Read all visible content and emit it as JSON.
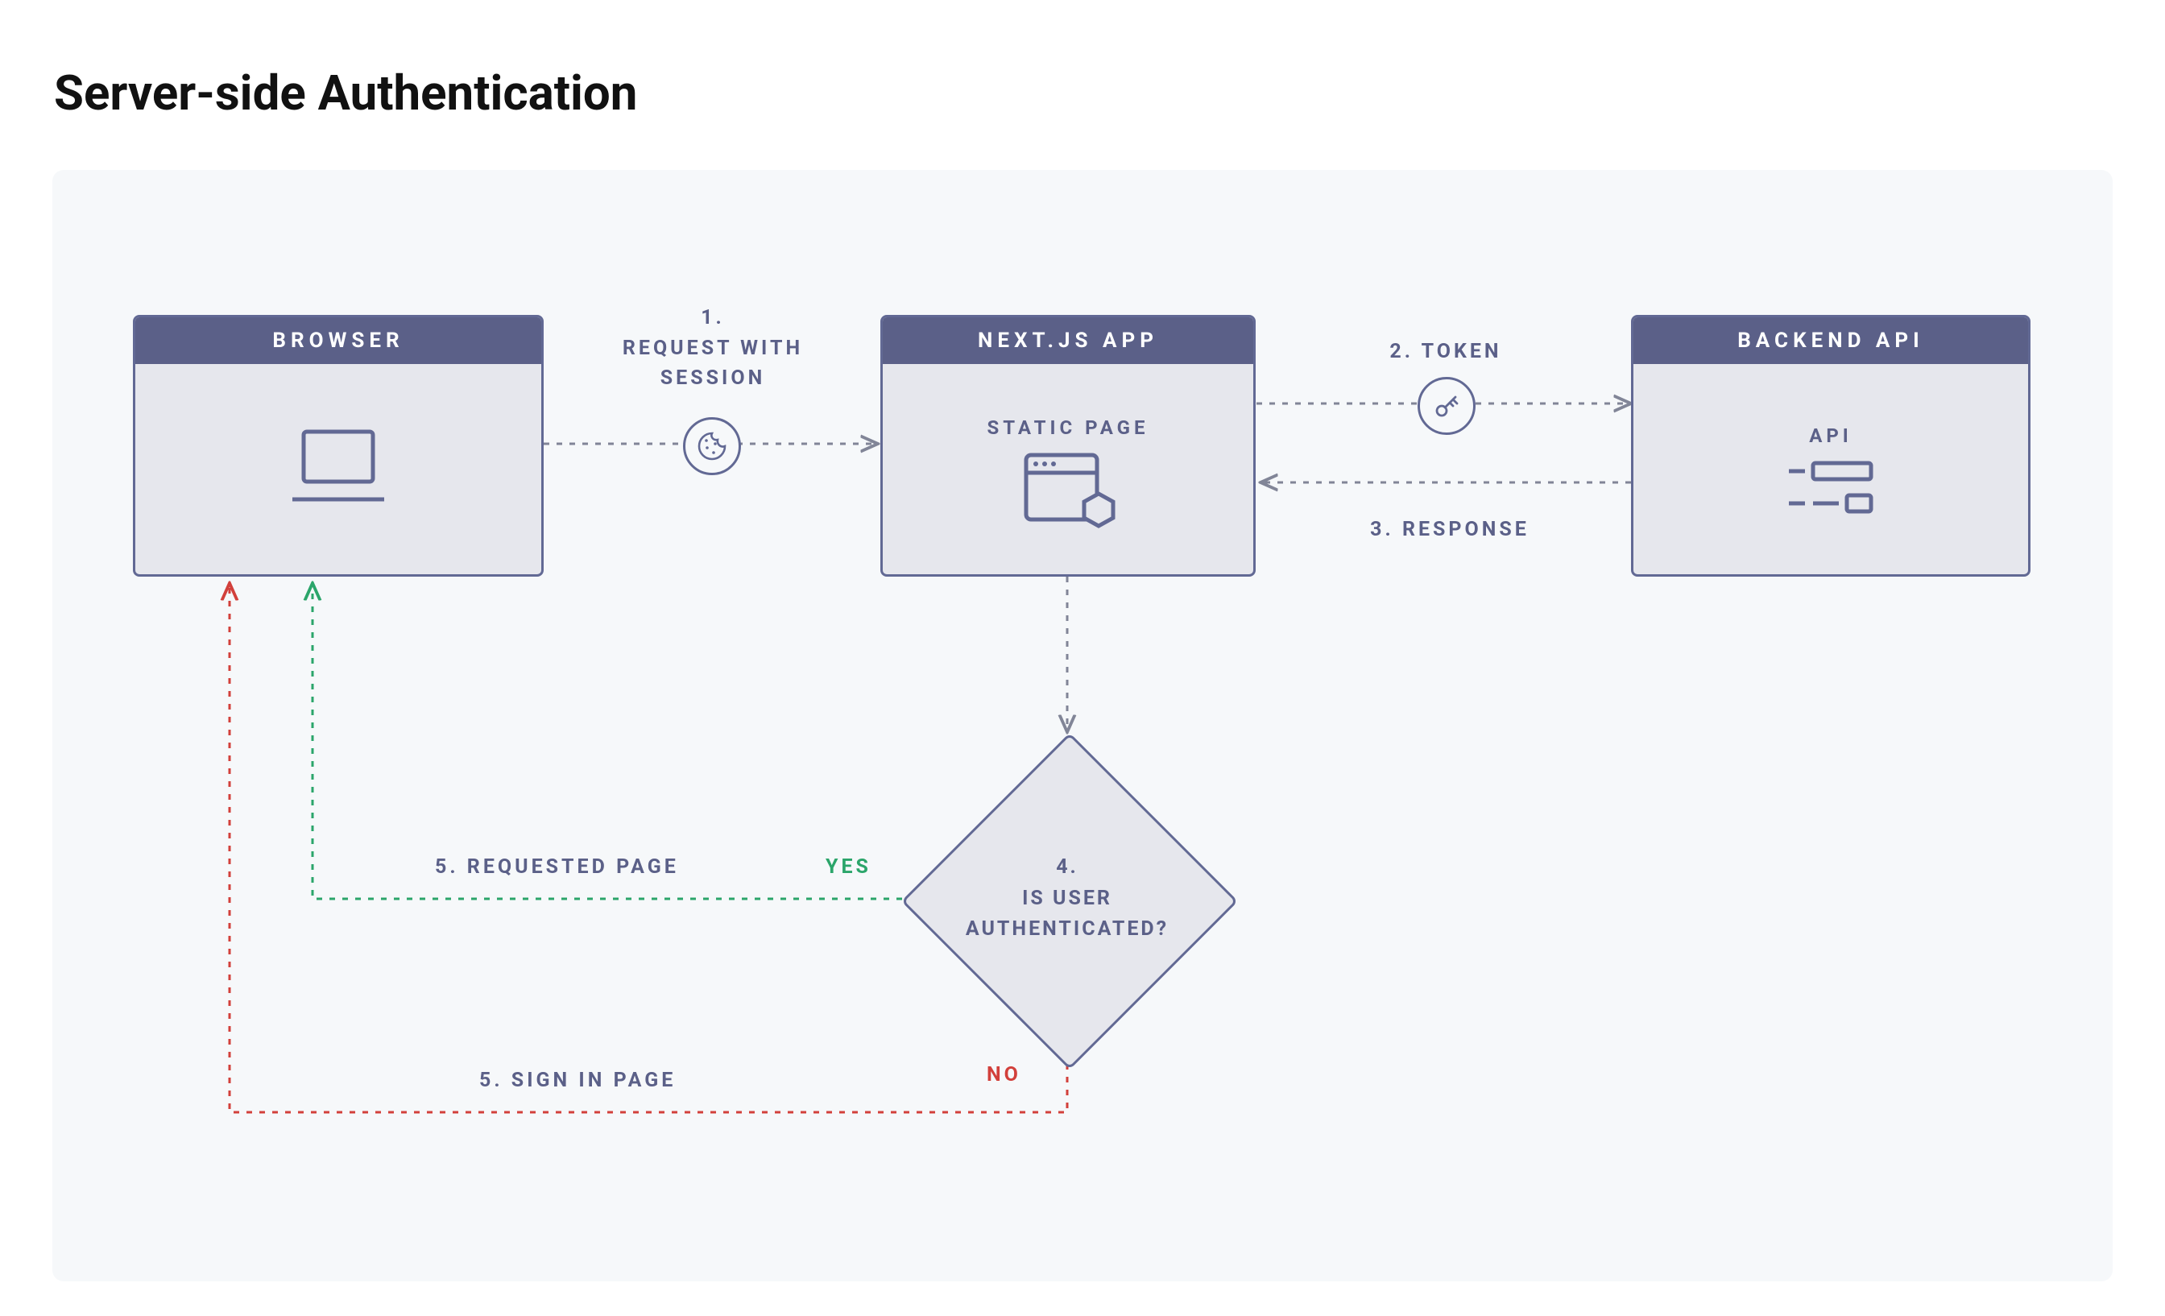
{
  "title": "Server-side Authentication",
  "nodes": {
    "browser": {
      "header": "BROWSER"
    },
    "nextjs": {
      "header": "NEXT.JS APP",
      "sub": "STATIC PAGE"
    },
    "backend": {
      "header": "BACKEND API",
      "sub": "API"
    },
    "decision": {
      "line1": "4.",
      "line2": "IS USER",
      "line3": "AUTHENTICATED?"
    }
  },
  "edges": {
    "e1": {
      "num": "1.",
      "label": "REQUEST WITH\nSESSION"
    },
    "e2": {
      "num": "2.",
      "label": "TOKEN"
    },
    "e3": {
      "num": "3.",
      "label": "RESPONSE"
    },
    "yes": "YES",
    "no": "NO",
    "e5a": "5. REQUESTED PAGE",
    "e5b": "5. SIGN IN PAGE"
  },
  "colors": {
    "header": "#5B6088",
    "boxFill": "#E6E7ED",
    "boxBorder": "#626994",
    "canvas": "#F6F8FA",
    "green": "#2BA56A",
    "red": "#D2403B",
    "dash": "#818597"
  }
}
